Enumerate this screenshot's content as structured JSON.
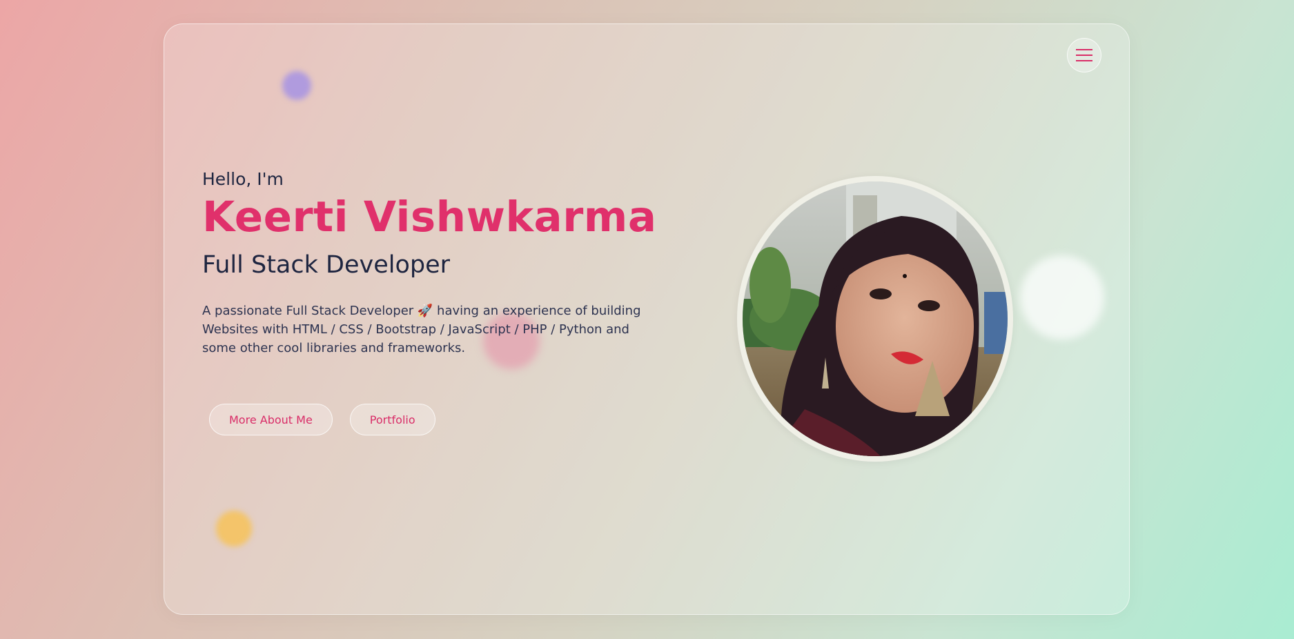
{
  "hero": {
    "greeting": "Hello, I'm",
    "name": "Keerti Vishwkarma",
    "role": "Full Stack Developer",
    "description": "A passionate Full Stack Developer 🚀 having an experience of building Websites with HTML / CSS / Bootstrap / JavaScript / PHP / Python and some other cool libraries and frameworks."
  },
  "buttons": {
    "about_label": "More About Me",
    "portfolio_label": "Portfolio"
  },
  "menu": {
    "icon": "hamburger-menu-icon"
  },
  "profile": {
    "photo": "profile-photo"
  },
  "colors": {
    "accent": "#e0306b",
    "text": "#1e2540"
  }
}
